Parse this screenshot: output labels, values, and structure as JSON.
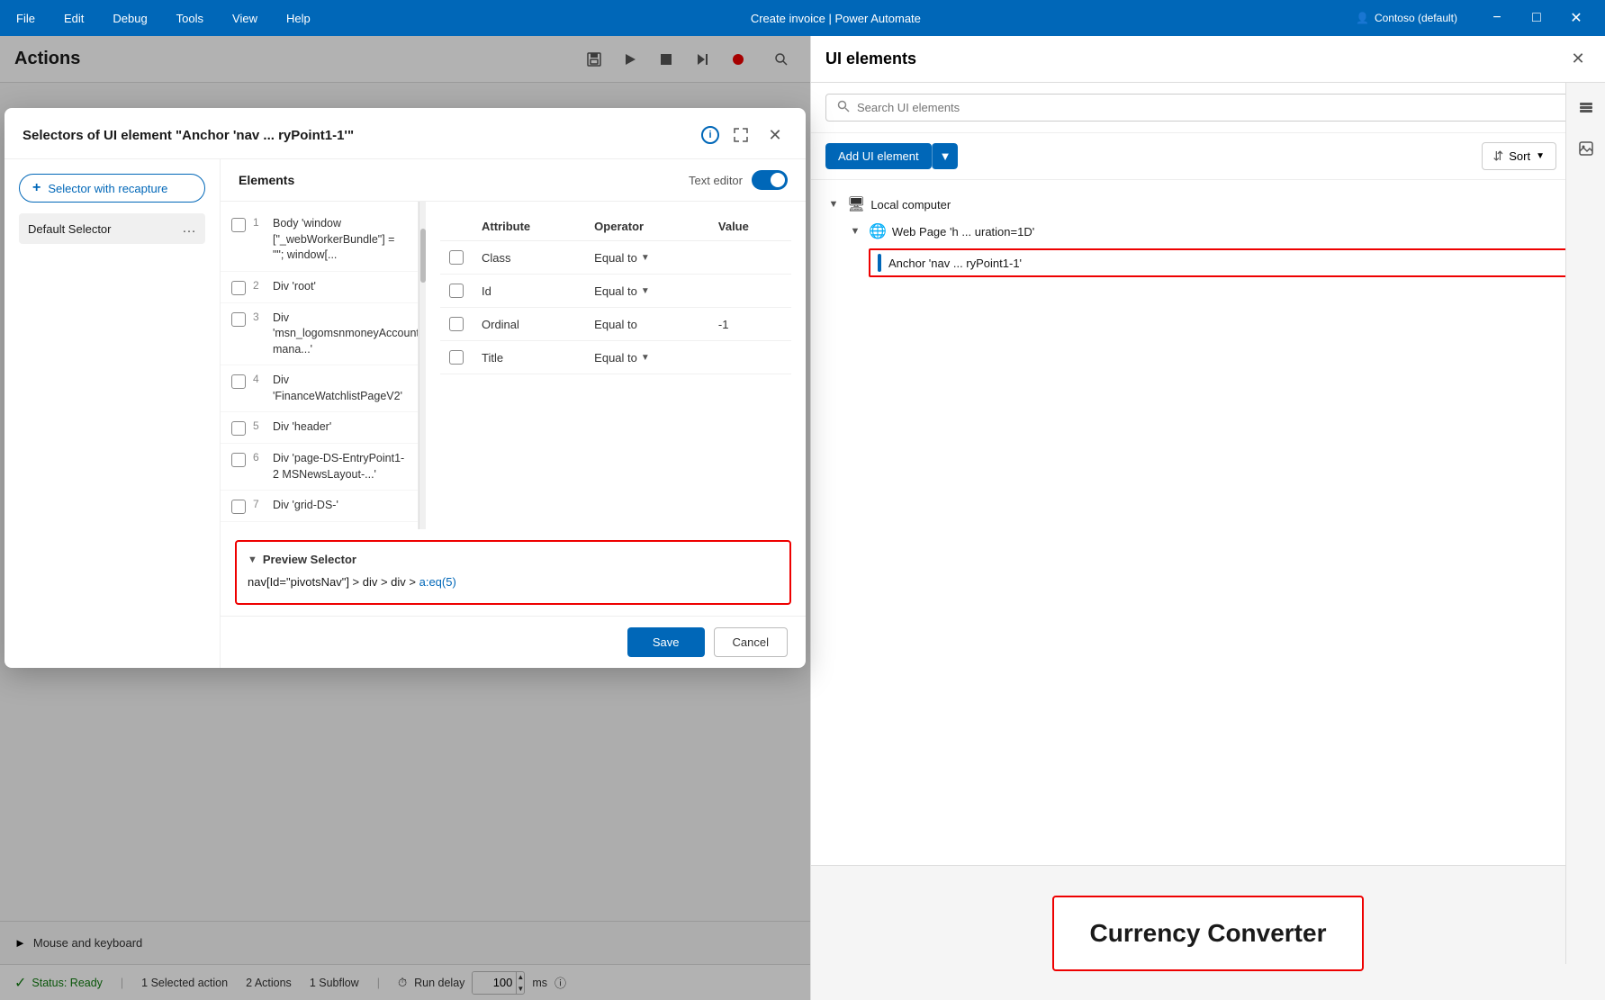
{
  "titlebar": {
    "menus": [
      "File",
      "Edit",
      "Debug",
      "Tools",
      "View",
      "Help"
    ],
    "title": "Create invoice | Power Automate",
    "org": "Contoso (default)"
  },
  "actions": {
    "title": "Actions"
  },
  "dialog": {
    "title": "Selectors of UI element \"Anchor 'nav ... ryPoint1-1'\"",
    "info_label": "i",
    "selector_recapture_label": "Selector with recapture",
    "default_selector_label": "Default Selector",
    "elements_section_label": "Elements",
    "text_editor_label": "Text editor",
    "elements": [
      {
        "num": "1",
        "text": "Body 'window [\"_webWorkerBundle\"] = \"\"; window[..."
      },
      {
        "num": "2",
        "text": "Div 'root'"
      },
      {
        "num": "3",
        "text": "Div 'msn_logomsnmoneyAccount mana...'"
      },
      {
        "num": "4",
        "text": "Div 'FinanceWatchlistPageV2'"
      },
      {
        "num": "5",
        "text": "Div 'header'"
      },
      {
        "num": "6",
        "text": "Div 'page-DS-EntryPoint1-2 MSNewsLayout-...'"
      },
      {
        "num": "7",
        "text": "Div 'grid-DS-'"
      }
    ],
    "attributes": {
      "col_attribute": "Attribute",
      "col_operator": "Operator",
      "col_value": "Value",
      "rows": [
        {
          "attr": "Class",
          "operator": "Equal to",
          "value": ""
        },
        {
          "attr": "Id",
          "operator": "Equal to",
          "value": ""
        },
        {
          "attr": "Ordinal",
          "operator": "Equal to",
          "value": "-1"
        },
        {
          "attr": "Title",
          "operator": "Equal to",
          "value": ""
        }
      ]
    },
    "preview_label": "Preview Selector",
    "preview_code_black1": "nav[Id=\"pivotsNav\"] > div > div > ",
    "preview_code_blue": "a:eq(5)",
    "save_label": "Save",
    "cancel_label": "Cancel"
  },
  "ui_elements": {
    "title": "UI elements",
    "search_placeholder": "Search UI elements",
    "add_ui_label": "Add UI element",
    "sort_label": "Sort",
    "tree": {
      "local_computer": "Local computer",
      "webpage": "Web Page 'h ... uration=1D'",
      "anchor": "Anchor 'nav ... ryPoint1-1'"
    }
  },
  "preview": {
    "currency_converter_label": "Currency Converter"
  },
  "statusbar": {
    "status_label": "Status: Ready",
    "selected_action_label": "1 Selected action",
    "actions_label": "2 Actions",
    "subflow_label": "1 Subflow",
    "run_delay_label": "Run delay",
    "run_delay_value": "100",
    "run_delay_unit": "ms",
    "info_icon": "ℹ"
  },
  "bottom_section": {
    "mouse_keyboard_label": "Mouse and keyboard"
  }
}
